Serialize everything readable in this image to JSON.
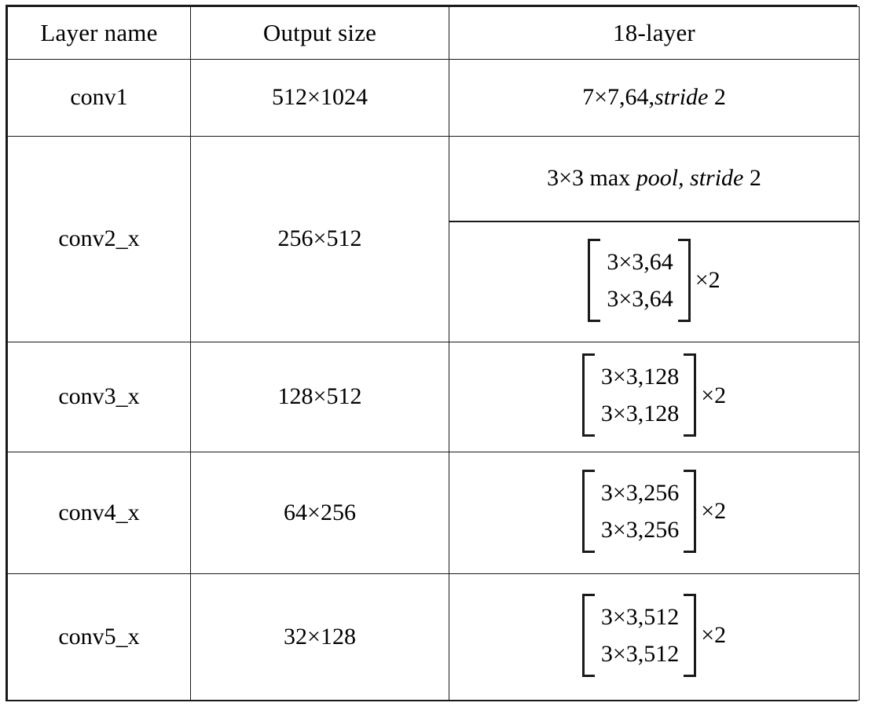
{
  "table": {
    "headers": [
      "Layer name",
      "Output size",
      "18-layer"
    ],
    "rows": [
      {
        "layer": "conv1",
        "output_size": "512×1024",
        "ops": [
          {
            "kind": "text",
            "pre": "7×7,64,",
            "italic": "stride",
            "post": "2"
          }
        ]
      },
      {
        "layer": "conv2_x",
        "output_size": "256×512",
        "ops": [
          {
            "kind": "text",
            "pre": "3×3  max",
            "italic": "pool, stride",
            "post": "2"
          },
          {
            "kind": "matrix",
            "line1": "3×3,64",
            "line2": "3×3,64",
            "multiplier": "×2"
          }
        ]
      },
      {
        "layer": "conv3_x",
        "output_size": "128×512",
        "ops": [
          {
            "kind": "matrix",
            "line1": "3×3,128",
            "line2": "3×3,128",
            "multiplier": "×2"
          }
        ]
      },
      {
        "layer": "conv4_x",
        "output_size": "64×256",
        "ops": [
          {
            "kind": "matrix",
            "line1": "3×3,256",
            "line2": "3×3,256",
            "multiplier": "×2"
          }
        ]
      },
      {
        "layer": "conv5_x",
        "output_size": "32×128",
        "ops": [
          {
            "kind": "matrix",
            "line1": "3×3,512",
            "line2": "3×3,512",
            "multiplier": "×2"
          }
        ]
      }
    ],
    "colors": {
      "border": "#1a1a1a",
      "text": "#000000",
      "background": "#ffffff"
    }
  }
}
